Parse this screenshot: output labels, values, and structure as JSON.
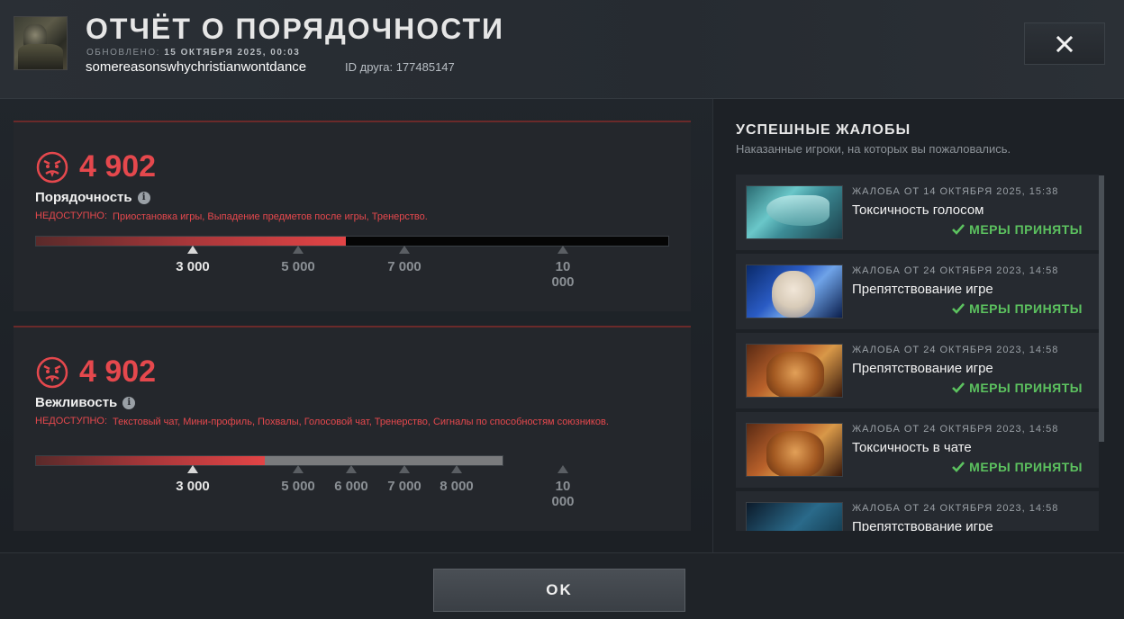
{
  "header": {
    "title": "ОТЧЁТ О ПОРЯДОЧНОСТИ",
    "updated_label": "ОБНОВЛЕНО:",
    "updated_value": "15 ОКТЯБРЯ 2025, 00:03",
    "username": "somereasonswhychristianwontdance",
    "friend_id": "ID друга: 177485147",
    "close_icon": "close-icon"
  },
  "conduct": {
    "score": "4 902",
    "label": "Порядочность",
    "unavailable_label": "НЕДОСТУПНО:",
    "unavailable_text": "Приостановка игры, Выпадение предметов после игры, Тренерство.",
    "progress_fraction": 0.49,
    "ticks": [
      {
        "label": "3 000",
        "active": true
      },
      {
        "label": "5 000",
        "active": false
      },
      {
        "label": "7 000",
        "active": false
      },
      {
        "label": "10 000",
        "active": false
      }
    ]
  },
  "politeness": {
    "score": "4 902",
    "label": "Вежливость",
    "unavailable_label": "НЕДОСТУПНО:",
    "unavailable_text": "Текстовый чат, Мини-профиль, Похвалы, Голосовой чат, Тренерство, Сигналы по способностям союзников.",
    "progress_fraction": 0.49,
    "ticks": [
      {
        "label": "3 000",
        "active": true
      },
      {
        "label": "5 000",
        "active": false
      },
      {
        "label": "6 000",
        "active": false
      },
      {
        "label": "7 000",
        "active": false
      },
      {
        "label": "8 000",
        "active": false
      },
      {
        "label": "10 000",
        "active": false
      }
    ]
  },
  "reports": {
    "title": "УСПЕШНЫЕ ЖАЛОБЫ",
    "subtitle": "Наказанные игроки, на которых вы пожаловались.",
    "status_color": "#5cc25f",
    "items": [
      {
        "date": "ЖАЛОБА ОТ 14 ОКТЯБРЯ 2025, 15:38",
        "reason": "Токсичность голосом",
        "status": "МЕРЫ ПРИНЯТЫ"
      },
      {
        "date": "ЖАЛОБА ОТ 24 ОКТЯБРЯ 2023, 14:58",
        "reason": "Препятствование игре",
        "status": "МЕРЫ ПРИНЯТЫ"
      },
      {
        "date": "ЖАЛОБА ОТ 24 ОКТЯБРЯ 2023, 14:58",
        "reason": "Препятствование игре",
        "status": "МЕРЫ ПРИНЯТЫ"
      },
      {
        "date": "ЖАЛОБА ОТ 24 ОКТЯБРЯ 2023, 14:58",
        "reason": "Токсичность в чате",
        "status": "МЕРЫ ПРИНЯТЫ"
      },
      {
        "date": "ЖАЛОБА ОТ 24 ОКТЯБРЯ 2023, 14:58",
        "reason": "Препятствование игре",
        "status": ""
      }
    ]
  },
  "footer": {
    "ok_label": "OK"
  },
  "colors": {
    "accent_red": "#e5484d",
    "success_green": "#5cc25f"
  }
}
